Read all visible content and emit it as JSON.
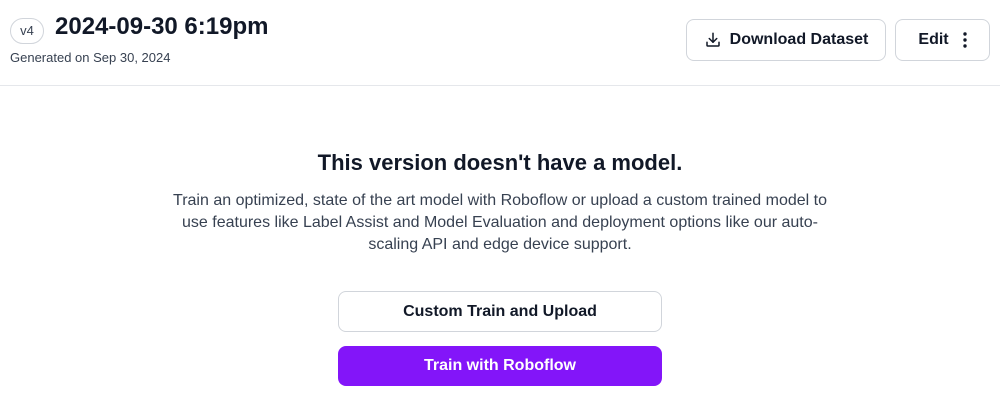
{
  "header": {
    "version_badge": "v4",
    "title": "2024-09-30 6:19pm",
    "generated": "Generated on Sep 30, 2024",
    "download_label": "Download Dataset",
    "edit_label": "Edit"
  },
  "empty_state": {
    "title": "This version doesn't have a model.",
    "description": "Train an optimized, state of the art model with Roboflow or upload a custom trained model to use features like Label Assist and Model Evaluation and deployment options like our auto-scaling API and edge device support.",
    "custom_button": "Custom Train and Upload",
    "train_button": "Train with Roboflow"
  },
  "colors": {
    "accent": "#8315f9",
    "border": "#d1d5db"
  },
  "icons": {
    "download": "download-icon",
    "more": "more-vertical-icon"
  }
}
